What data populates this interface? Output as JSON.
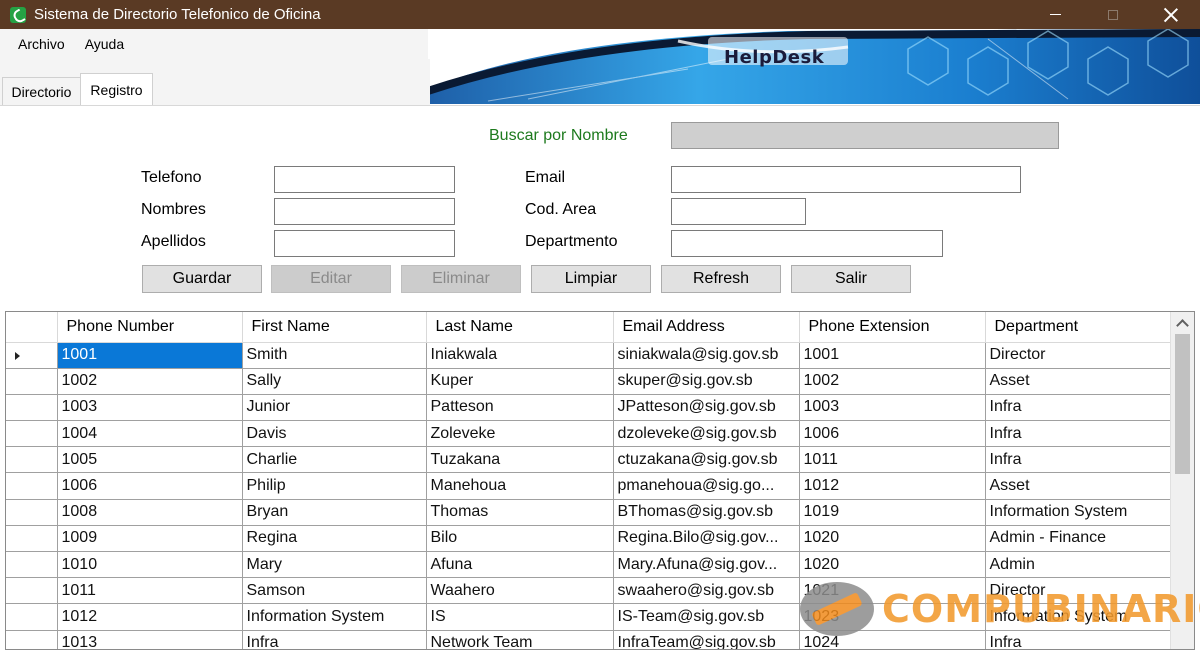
{
  "window": {
    "title": "Sistema de Directorio Telefonico de Oficina"
  },
  "menu": {
    "items": [
      "Archivo",
      "Ayuda"
    ]
  },
  "banner": {
    "text": "HelpDesk"
  },
  "tabs": {
    "items": [
      "Directorio",
      "Registro"
    ],
    "active": "Registro"
  },
  "form": {
    "search_label": "Buscar por Nombre",
    "search_value": "",
    "telefono_label": "Telefono",
    "nombres_label": "Nombres",
    "apellidos_label": "Apellidos",
    "email_label": "Email",
    "cod_area_label": "Cod. Area",
    "departamento_label": "Departmento",
    "telefono_value": "",
    "nombres_value": "",
    "apellidos_value": "",
    "email_value": "",
    "cod_area_value": "",
    "departamento_value": ""
  },
  "buttons": {
    "guardar": "Guardar",
    "editar": "Editar",
    "eliminar": "Eliminar",
    "limpiar": "Limpiar",
    "refresh": "Refresh",
    "salir": "Salir"
  },
  "grid": {
    "columns": [
      "Phone Number",
      "First Name",
      "Last Name",
      "Email Address",
      "Phone Extension",
      "Department"
    ],
    "rows": [
      [
        "1001",
        "Smith",
        "Iniakwala",
        "siniakwala@sig.gov.sb",
        "1001",
        "Director"
      ],
      [
        "1002",
        "Sally",
        "Kuper",
        "skuper@sig.gov.sb",
        "1002",
        "Asset"
      ],
      [
        "1003",
        "Junior",
        "Patteson",
        "JPatteson@sig.gov.sb",
        "1003",
        "Infra"
      ],
      [
        "1004",
        "Davis",
        "Zoleveke",
        "dzoleveke@sig.gov.sb",
        "1006",
        "Infra"
      ],
      [
        "1005",
        "Charlie",
        "Tuzakana",
        "ctuzakana@sig.gov.sb",
        "1011",
        "Infra"
      ],
      [
        "1006",
        "Philip",
        "Manehoua",
        "pmanehoua@sig.go...",
        "1012",
        "Asset"
      ],
      [
        "1008",
        "Bryan",
        "Thomas",
        "BThomas@sig.gov.sb",
        "1019",
        "Information System"
      ],
      [
        "1009",
        "Regina",
        "Bilo",
        "Regina.Bilo@sig.gov...",
        "1020",
        "Admin - Finance"
      ],
      [
        "1010",
        "Mary",
        "Afuna",
        "Mary.Afuna@sig.gov...",
        "1020",
        "Admin"
      ],
      [
        "1011",
        "Samson",
        "Waahero",
        "swaahero@sig.gov.sb",
        "1021",
        "Director"
      ],
      [
        "1012",
        "Information System",
        "IS",
        "IS-Team@sig.gov.sb",
        "1023",
        "Information System"
      ],
      [
        "1013",
        "Infra",
        "Network Team",
        "InfraTeam@sig.gov.sb",
        "1024",
        "Infra"
      ]
    ]
  },
  "watermark": {
    "text": "COMPUBINARIO"
  },
  "colors": {
    "titlebar": "#5a3a24",
    "selection": "#0a78d7",
    "search_label": "#1d7a1d",
    "watermark": "#f29a2e"
  }
}
